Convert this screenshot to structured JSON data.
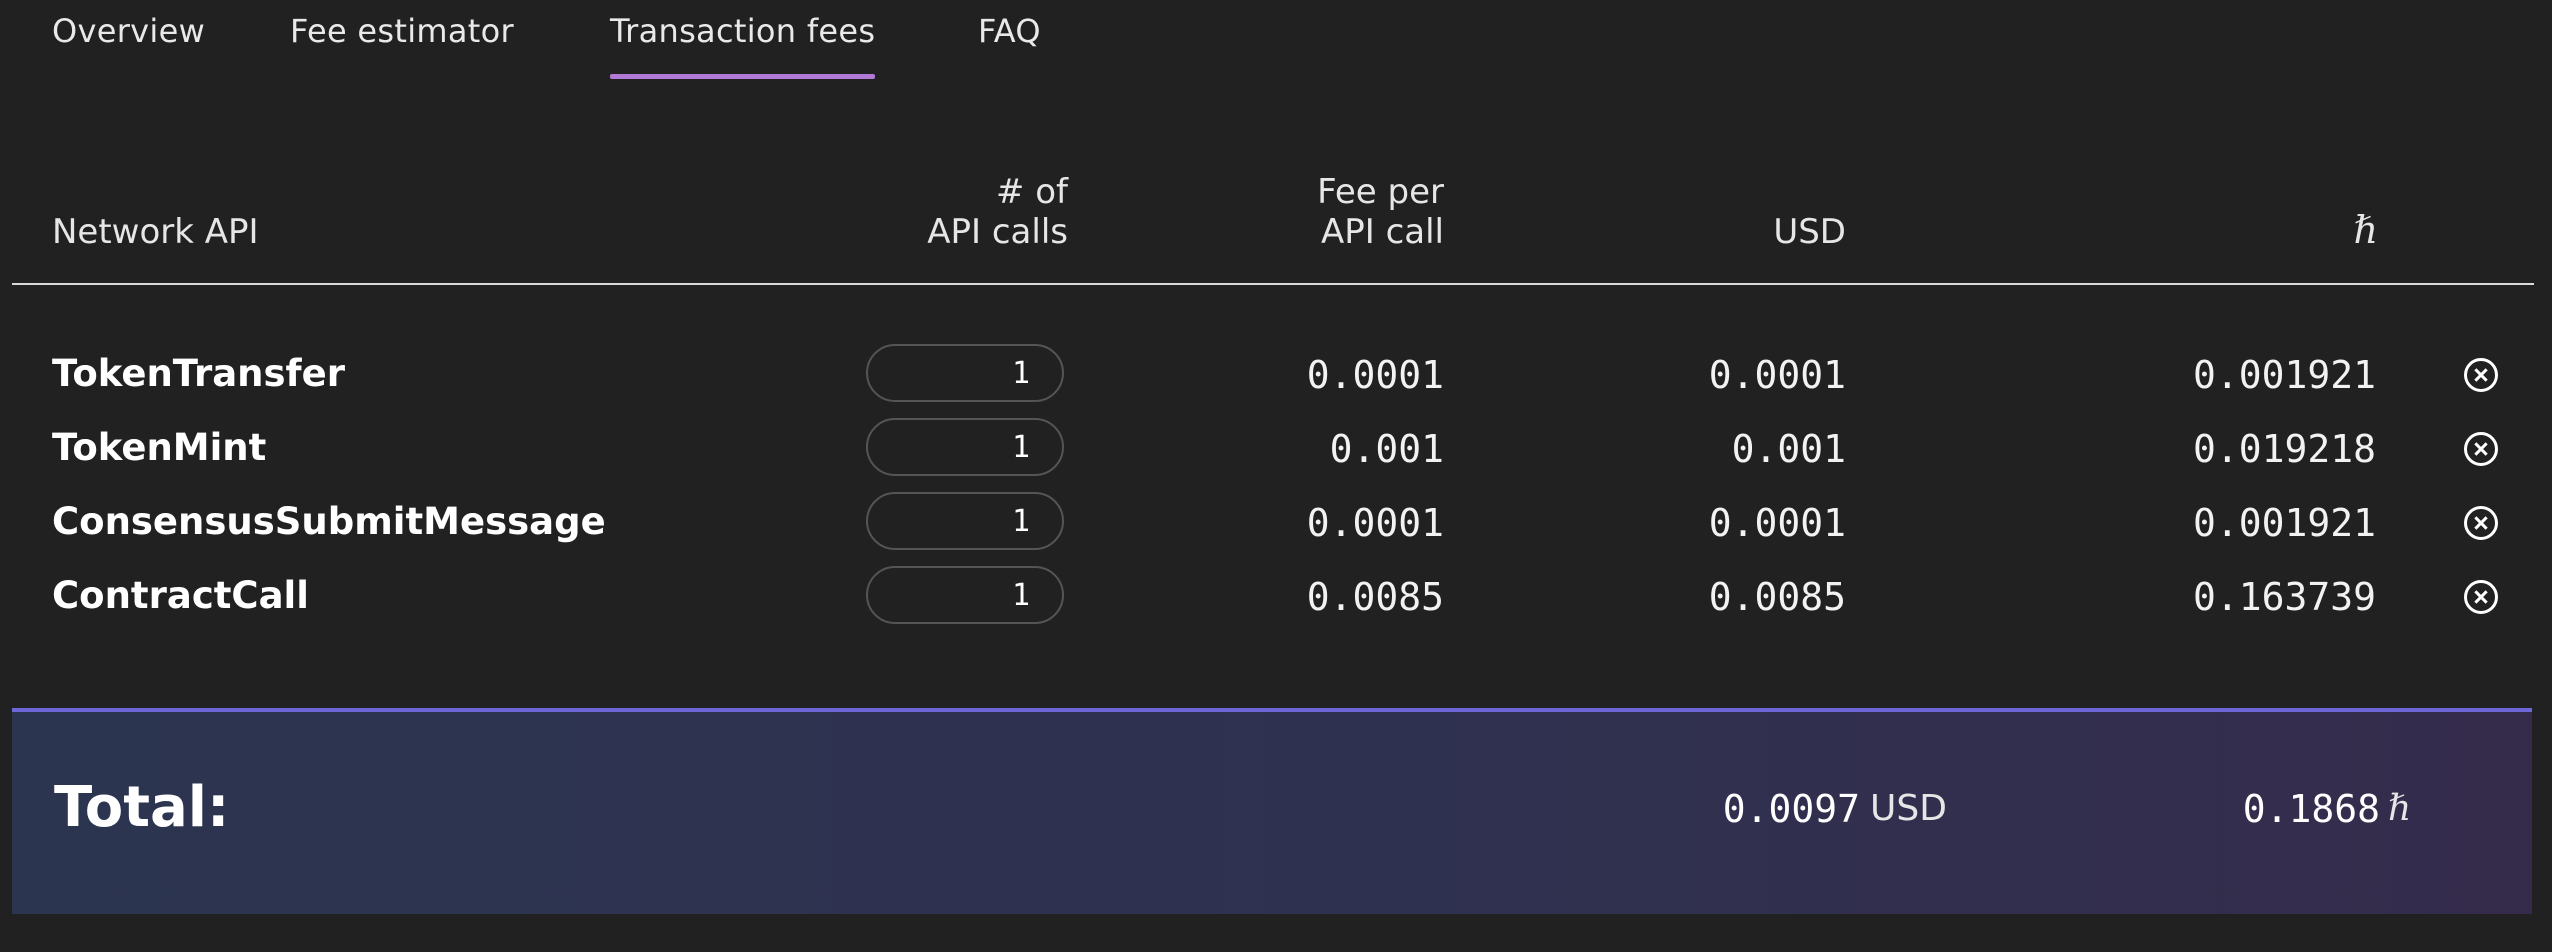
{
  "tabs": [
    {
      "label": "Overview"
    },
    {
      "label": "Fee estimator"
    },
    {
      "label": "Transaction fees",
      "active": true
    },
    {
      "label": "FAQ"
    }
  ],
  "table": {
    "headers": {
      "api": "Network API",
      "calls_line1": "# of",
      "calls_line2": "API calls",
      "fee_line1": "Fee per",
      "fee_line2": "API call",
      "usd": "USD",
      "hbar": "ℏ"
    },
    "rows": [
      {
        "api": "TokenTransfer",
        "calls": "1",
        "fee": "0.0001",
        "usd": "0.0001",
        "hbar": "0.001921"
      },
      {
        "api": "TokenMint",
        "calls": "1",
        "fee": "0.001",
        "usd": "0.001",
        "hbar": "0.019218"
      },
      {
        "api": "ConsensusSubmitMessage",
        "calls": "1",
        "fee": "0.0001",
        "usd": "0.0001",
        "hbar": "0.001921"
      },
      {
        "api": "ContractCall",
        "calls": "1",
        "fee": "0.0085",
        "usd": "0.0085",
        "hbar": "0.163739"
      }
    ]
  },
  "total": {
    "label": "Total:",
    "usd_value": "0.0097",
    "usd_unit": "USD",
    "hbar_value": "0.1868",
    "hbar_unit": "ℏ"
  },
  "colors": {
    "background": "#212121",
    "tab_underline": "#b07ad6",
    "total_border": "#6f66d8"
  }
}
